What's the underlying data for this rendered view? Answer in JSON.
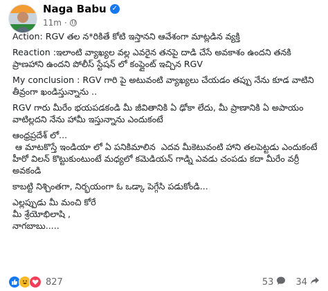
{
  "post": {
    "author": "Naga Babu",
    "timestamp": "11m",
    "meta_separator": "·",
    "paragraphs": [
      "Action: RGV తల న*రికితే కోటి ఇస్తానని ఆవేశంగా మాట్లడిన వ్యక్తి",
      "Reaction :ఇలాంటి వ్యాఖ్యల వల్ల ఎవరైన తనపై దాడి చేసే అవకాశం ఉందని తనకి ప్రాణహాని ఉందని పోలీస్ స్టేషన్ లో కంప్లైంట్ ఇచ్చిన RGV",
      "My conclusion : RGV గారి పై అటువంటి వ్యాఖ్యలు చేయడం తప్పు నేను కూడ వాటిని తీవ్రంగా ఖండిస్తున్నాను ..",
      "RGV గారు మీరేం భయపడకండి మీ జీవితానికి ఏ ఢోకా లేదు, మీ ప్రాణానికి ఏ అపాయం వాటిల్లదని నేను హామీ ఇస్తున్నాను ఎందుకంటే",
      "ఆంధ్రప్రదేశ్ లో...\n ఆ మాటకొస్తే ఇండియా లో ఏ పనికిమాలిన  ఎదవ మీకెటువంటి హాని తలపెట్టడు ఎందుకంటే హీరో విలన్ కొట్టుకుంటుంటే మధ్యలో కమెడియన్ గాడ్ని ఎవడు చంపడు కదా మీరేం వర్రీ అవకండి",
      "కాబట్టి నిశ్చింతగా, నిర్భయంగా ఓ ఒడ్కా పెగ్గేసి పడుకోండి...",
      "ఎల్లప్పుడు మీ మంచి కోరే\nమీ శ్రేయోభిలాషి ,\nనాగబాబు....."
    ]
  },
  "reactions": {
    "count": "827",
    "icons": [
      "like-icon",
      "haha-icon",
      "love-icon"
    ]
  },
  "comments": {
    "count": "53"
  },
  "shares": {
    "count": "34"
  },
  "colors": {
    "like": "#1877f2",
    "haha": "#f7b928",
    "love": "#f33e58",
    "verified": "#1877f2"
  }
}
